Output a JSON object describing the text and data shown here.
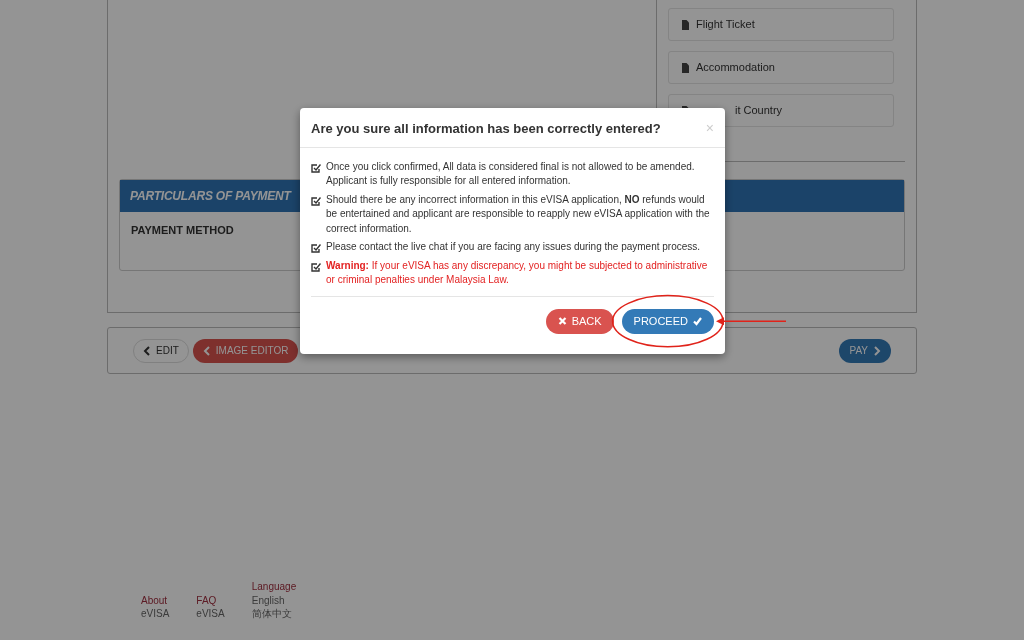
{
  "documents": [
    {
      "label": "Flight Ticket"
    },
    {
      "label": "Accommodation"
    },
    {
      "label": "it Country"
    }
  ],
  "payment": {
    "header": "PARTICULARS OF PAYMENT",
    "field_label": "PAYMENT METHOD"
  },
  "actions": [
    {
      "label": "EDIT",
      "kind": "outline"
    },
    {
      "label": "IMAGE EDITOR",
      "kind": "danger"
    },
    {
      "label": "PAY",
      "kind": "primary"
    }
  ],
  "footer": {
    "columns": [
      {
        "links": [
          "About",
          "eVISA"
        ]
      },
      {
        "links": [
          "FAQ",
          "eVISA"
        ]
      },
      {
        "heading": "Language",
        "links": [
          "English",
          "简体中文"
        ]
      }
    ]
  },
  "modal": {
    "title": "Are you sure all information has been correctly entered?",
    "close": "×",
    "items": [
      {
        "kind": "normal",
        "text": "Once you click confirmed, All data is considered final is not allowed to be amended. Applicant is fully responsible for all entered information."
      },
      {
        "kind": "normal",
        "text": "Should there be any incorrect information in this eVISA application, **NO** refunds would be entertained and applicant are responsible to reapply new eVISA application with the correct information."
      },
      {
        "kind": "normal",
        "text": "Please contact the live chat if you are facing any issues during the payment process."
      },
      {
        "kind": "warning",
        "text": "**Warning:** If your eVISA has any discrepancy, you might be subjected to administrative or criminal penalties under Malaysia Law."
      }
    ],
    "buttons": [
      {
        "label": "BACK",
        "kind": "danger",
        "highlighted": false
      },
      {
        "label": "PROCEED",
        "kind": "primary",
        "highlighted": true
      }
    ]
  }
}
